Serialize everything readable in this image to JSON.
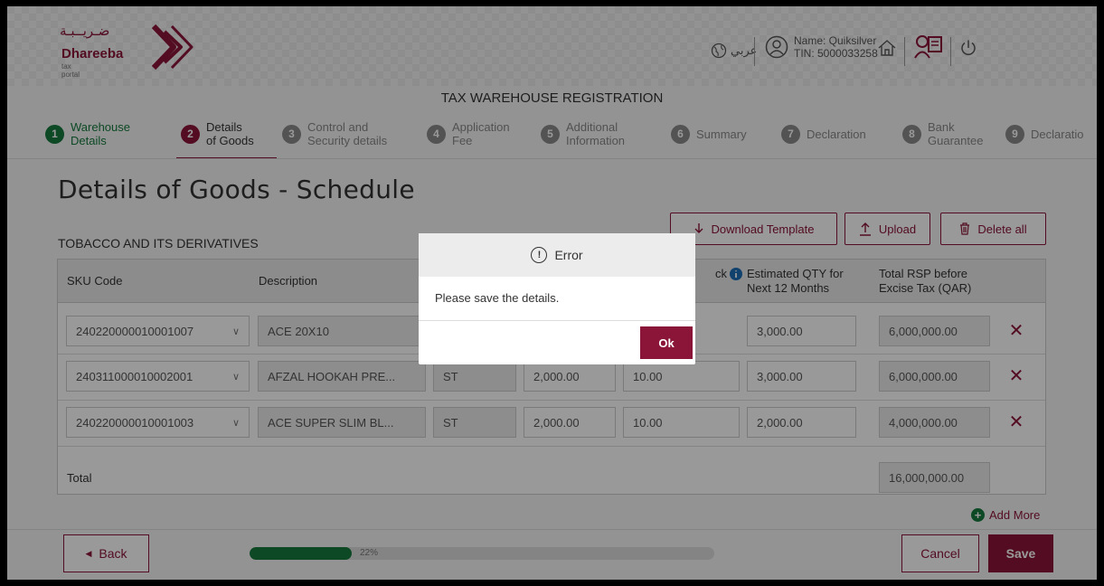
{
  "brand": {
    "arabic": "ضـريــبـة",
    "name": "Dhareeba",
    "subtitle": "tax portal",
    "color": "#8a1538"
  },
  "header": {
    "lang_label": "عربي",
    "user_name": "Name: Quiksilver",
    "user_tin": "TIN: 5000033258"
  },
  "page_heading": "TAX WAREHOUSE REGISTRATION",
  "steps": [
    {
      "num": "1",
      "line1": "Warehouse",
      "line2": "Details",
      "state": "done"
    },
    {
      "num": "2",
      "line1": "Details",
      "line2": "of Goods",
      "state": "active"
    },
    {
      "num": "3",
      "line1": "Control and",
      "line2": "Security details",
      "state": "pending"
    },
    {
      "num": "4",
      "line1": "Application",
      "line2": "Fee",
      "state": "pending"
    },
    {
      "num": "5",
      "line1": "Additional",
      "line2": "Information",
      "state": "pending"
    },
    {
      "num": "6",
      "line1": "Summary",
      "line2": "",
      "state": "pending"
    },
    {
      "num": "7",
      "line1": "Declaration",
      "line2": "",
      "state": "pending"
    },
    {
      "num": "8",
      "line1": "Bank",
      "line2": "Guarantee",
      "state": "pending"
    },
    {
      "num": "9",
      "line1": "Declaratio",
      "line2": "",
      "state": "pending"
    }
  ],
  "section_title": "Details of Goods - Schedule",
  "toolbar": {
    "download_label": "Download Template",
    "upload_label": "Upload",
    "delete_all_label": "Delete all"
  },
  "table": {
    "category": "TOBACCO AND ITS DERIVATIVES",
    "columns": {
      "sku": "SKU Code",
      "description": "Description",
      "stock_fragment": "ck",
      "est_qty_1": "Estimated QTY for",
      "est_qty_2": "Next 12 Months",
      "rsp_1": "Total RSP before",
      "rsp_2": "Excise Tax (QAR)"
    },
    "rows": [
      {
        "sku": "240220000010001007",
        "description": "ACE 20X10",
        "unit": "",
        "price": "",
        "stock": "",
        "est_qty": "3,000.00",
        "rsp": "6,000,000.00"
      },
      {
        "sku": "240311000010002001",
        "description": "AFZAL HOOKAH PRE...",
        "unit": "ST",
        "price": "2,000.00",
        "stock": "10.00",
        "est_qty": "3,000.00",
        "rsp": "6,000,000.00"
      },
      {
        "sku": "240220000010001003",
        "description": "ACE SUPER SLIM BL...",
        "unit": "ST",
        "price": "2,000.00",
        "stock": "10.00",
        "est_qty": "2,000.00",
        "rsp": "4,000,000.00"
      }
    ],
    "total_label": "Total",
    "total_value": "16,000,000.00"
  },
  "add_more_label": "Add More",
  "footer": {
    "back_label": "Back",
    "progress_text": "22%",
    "progress_percent": 22,
    "cancel_label": "Cancel",
    "save_label": "Save"
  },
  "modal": {
    "title": "Error",
    "message": "Please save the details.",
    "ok_label": "Ok"
  }
}
